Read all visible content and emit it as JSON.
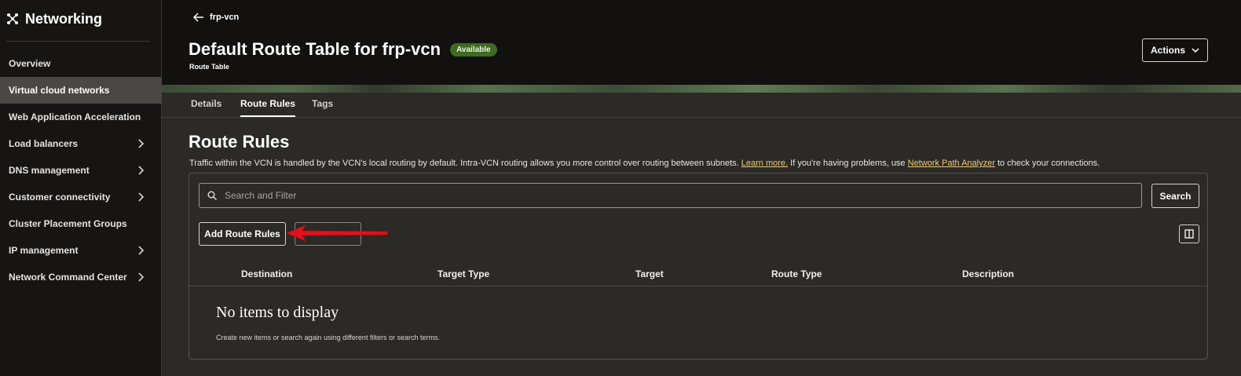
{
  "sidebar": {
    "title": "Networking",
    "items": [
      {
        "label": "Overview"
      },
      {
        "label": "Virtual cloud networks"
      },
      {
        "label": "Web Application Acceleration"
      },
      {
        "label": "Load balancers"
      },
      {
        "label": "DNS management"
      },
      {
        "label": "Customer connectivity"
      },
      {
        "label": "Cluster Placement Groups"
      },
      {
        "label": "IP management"
      },
      {
        "label": "Network Command Center"
      }
    ]
  },
  "header": {
    "back_label": "frp-vcn",
    "title": "Default Route Table for frp-vcn",
    "status": "Available",
    "subtitle": "Route Table",
    "actions_label": "Actions"
  },
  "tabs": [
    {
      "label": "Details"
    },
    {
      "label": "Route Rules"
    },
    {
      "label": "Tags"
    }
  ],
  "content": {
    "title": "Route Rules",
    "desc_before": "Traffic within the VCN is handled by the VCN's local routing by default. Intra-VCN routing allows you more control over routing between subnets. ",
    "learn_more": "Learn more.",
    "desc_middle": " If you're having problems, use ",
    "analyzer_link": "Network Path Analyzer",
    "desc_after": " to check your connections.",
    "search_placeholder": "Search and Filter",
    "search_button": "Search",
    "add_button": "Add Route Rules",
    "columns": [
      "Destination",
      "Target Type",
      "Target",
      "Route Type",
      "Description"
    ],
    "empty_title": "No items to display",
    "empty_subtitle": "Create new items or search again using different filters or search terms."
  },
  "colors": {
    "sidebar_bg": "#161513",
    "header_bg": "#121110",
    "content_bg": "#2b2a27",
    "status_badge": "#3d6b22",
    "link": "#f0cc6e",
    "annotation_arrow": "#e0121b"
  }
}
